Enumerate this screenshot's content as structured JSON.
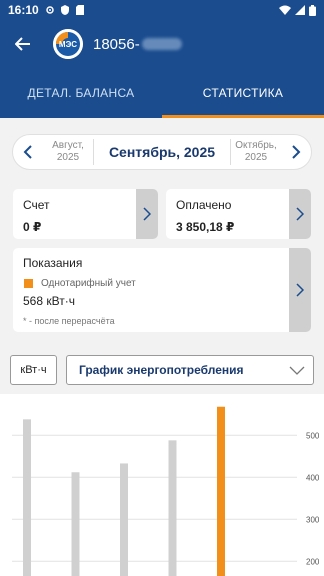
{
  "status": {
    "time": "16:10"
  },
  "header": {
    "account_prefix": "18056-"
  },
  "tabs": [
    {
      "label": "ДЕТАЛ. БАЛАНСА",
      "active": false
    },
    {
      "label": "СТАТИСТИКА",
      "active": true
    }
  ],
  "month": {
    "prev": "Август, 2025",
    "current": "Сентябрь, 2025",
    "next": "Октябрь, 2025"
  },
  "bill": {
    "title": "Счет",
    "value": "0 ₽"
  },
  "paid": {
    "title": "Оплачено",
    "value": "3 850,18 ₽"
  },
  "readings": {
    "title": "Показания",
    "tariff_label": "Однотарифный учет",
    "tariff_color": "#f28e1a",
    "value": "568 кВт·ч",
    "note": "* - после перерасчёта"
  },
  "controls": {
    "unit_label": "кВт·ч",
    "chart_type_label": "График энергопотребления"
  },
  "colors": {
    "header": "#1a4c8e",
    "accent": "#f28e1a",
    "bar": "#d0d0d0"
  },
  "chart_data": {
    "type": "bar",
    "y_ticks": [
      200,
      300,
      400,
      500
    ],
    "ylim": [
      165,
      565
    ],
    "values": [
      538,
      412,
      433,
      488,
      568
    ],
    "highlight_index": 4
  }
}
